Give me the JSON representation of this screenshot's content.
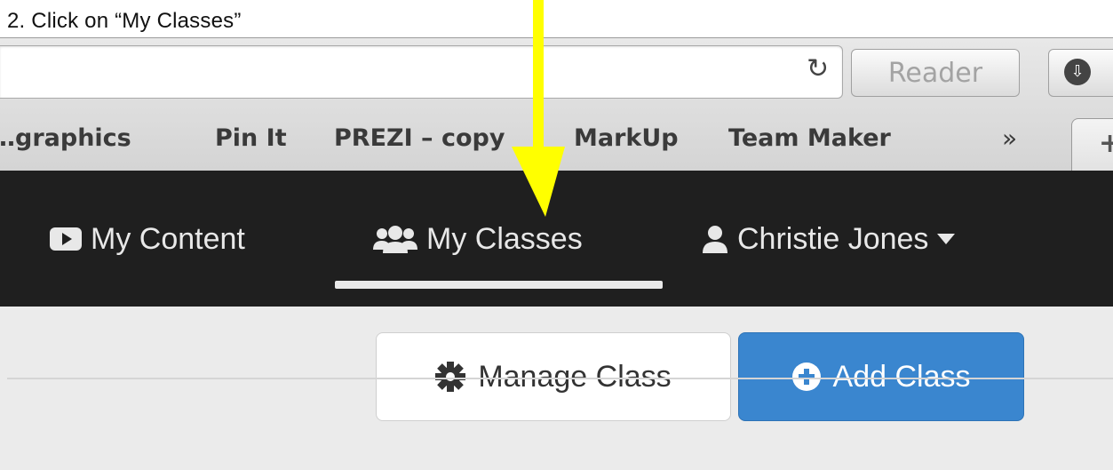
{
  "caption": "2. Click on “My Classes”",
  "browser": {
    "reload_icon": "↻",
    "reader_label": "Reader",
    "download_icon": "⇩",
    "overflow_label": "»",
    "newtab_label": "+",
    "bookmarks": [
      {
        "label": "…graphics"
      },
      {
        "label": "Pin It"
      },
      {
        "label": "PREZI – copy"
      },
      {
        "label": "MarkUp"
      },
      {
        "label": "Team Maker"
      }
    ]
  },
  "navbar": {
    "items": [
      {
        "label": "My Content",
        "icon": "video-play-icon"
      },
      {
        "label": "My Classes",
        "icon": "users-icon",
        "active": true
      },
      {
        "label": "Christie Jones",
        "icon": "user-icon"
      }
    ]
  },
  "toolbar": {
    "manage_label": "Manage Class",
    "add_label": "Add Class"
  },
  "colors": {
    "navbar": "#1f1f1f",
    "primary": "#3a86cf",
    "annotation_arrow": "#ffff00"
  }
}
